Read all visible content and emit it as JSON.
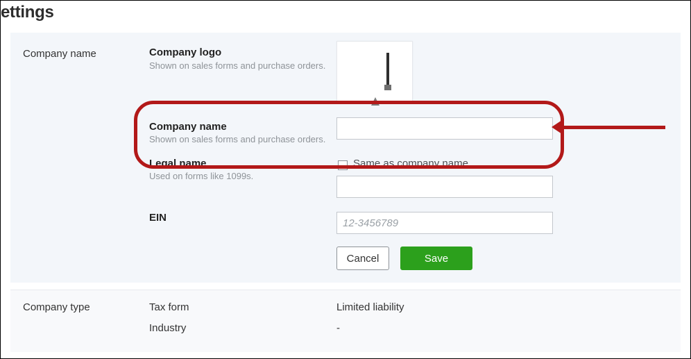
{
  "page": {
    "title_partial": "ettings"
  },
  "section_company_name": {
    "label": "Company name",
    "logo": {
      "heading": "Company logo",
      "subtext": "Shown on sales forms and purchase orders."
    },
    "company_name": {
      "heading": "Company name",
      "subtext": "Shown on sales forms and purchase orders.",
      "value": ""
    },
    "legal_name": {
      "heading": "Legal name",
      "subtext": "Used on forms like 1099s.",
      "checkbox_label": "Same as company name",
      "value": ""
    },
    "ein": {
      "heading": "EIN",
      "placeholder": "12-3456789",
      "value": ""
    },
    "buttons": {
      "cancel": "Cancel",
      "save": "Save"
    }
  },
  "section_company_type": {
    "label": "Company type",
    "tax_form": {
      "label": "Tax form",
      "value": "Limited liability"
    },
    "industry": {
      "label": "Industry",
      "value": "-"
    }
  }
}
